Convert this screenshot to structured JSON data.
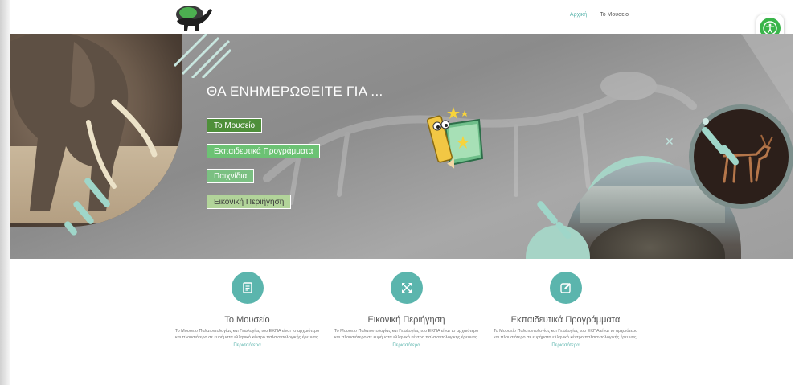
{
  "header": {
    "nav": [
      {
        "label": "Αρχική",
        "active": true
      },
      {
        "label": "Το Μουσείο",
        "active": false
      }
    ]
  },
  "hero": {
    "title": "ΘΑ ΕΝΗΜΕΡΩΘΕΙΤΕ ΓΙΑ ...",
    "buttons": [
      {
        "label": "Το Μουσείο"
      },
      {
        "label": "Εκπαιδευτικά Προγράμματα"
      },
      {
        "label": "Παιχνίδια"
      },
      {
        "label": "Εικονική Περιήγηση"
      }
    ]
  },
  "features": [
    {
      "icon": "document-icon",
      "title": "Το Μουσείο",
      "text": "Το Μουσείο Παλαιοντολογίας και Γεωλογίας του ΕΚΠΑ είναι το αρχαιότερο και πλουσιότερο σε ευρήματα ελληνικό κέντρο παλαιοντολογικής έρευνας.",
      "link": "Περισσότερα"
    },
    {
      "icon": "expand-icon",
      "title": "Εικονική Περιήγηση",
      "text": "Το Μουσείο Παλαιοντολογίας και Γεωλογίας του ΕΚΠΑ είναι το αρχαιότερο και πλουσιότερο σε ευρήματα ελληνικό κέντρο παλαιοντολογικής έρευνας.",
      "link": "Περισσότερα"
    },
    {
      "icon": "edit-icon",
      "title": "Εκπαιδευτικά Προγράμματα",
      "text": "Το Μουσείο Παλαιοντολογίας και Γεωλογίας του ΕΚΠΑ είναι το αρχαιότερο και πλουσιότερο σε ευρήματα ελληνικό κέντρο παλαιοντολογικής έρευνας.",
      "link": "Περισσότερα"
    }
  ],
  "colors": {
    "accent": "#5bb5ad",
    "hero_btn_dark": "#4e8f3a",
    "hero_btn_light": "#6cc274",
    "a11y_green": "#39b54a"
  }
}
